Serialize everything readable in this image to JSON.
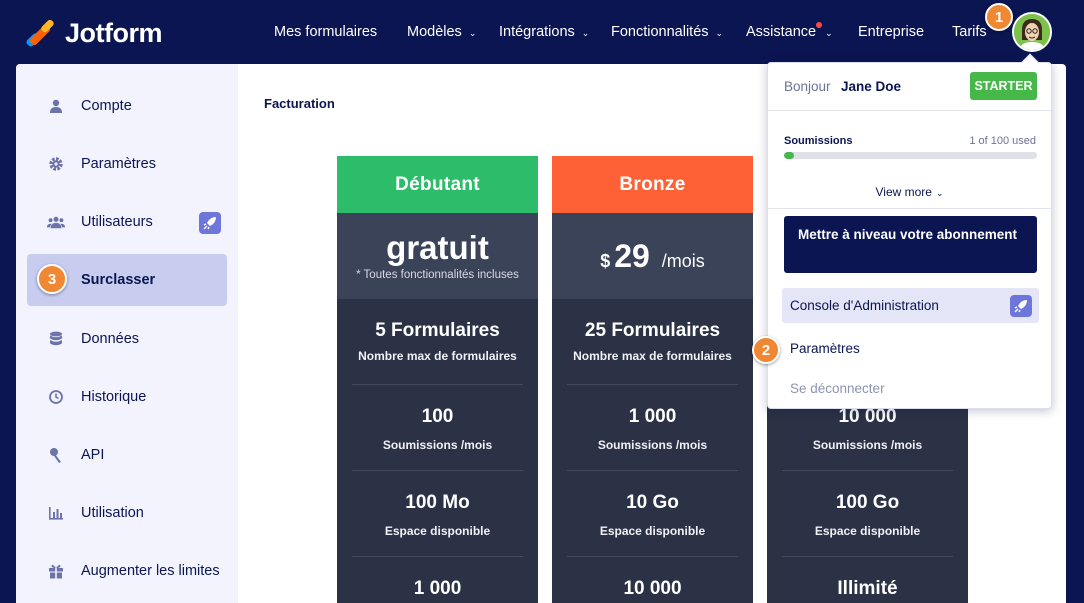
{
  "brand": {
    "name": "Jotform"
  },
  "nav": {
    "items": [
      {
        "label": "Mes formulaires",
        "dropdown": false
      },
      {
        "label": "Modèles",
        "dropdown": true
      },
      {
        "label": "Intégrations",
        "dropdown": true
      },
      {
        "label": "Fonctionnalités",
        "dropdown": true
      },
      {
        "label": "Assistance",
        "dropdown": true,
        "notification": true
      },
      {
        "label": "Entreprise",
        "dropdown": false
      },
      {
        "label": "Tarifs",
        "dropdown": false
      }
    ]
  },
  "callouts": {
    "one": "1",
    "two": "2",
    "three": "3"
  },
  "sidebar": {
    "items": [
      {
        "label": "Compte",
        "icon": "user-icon"
      },
      {
        "label": "Paramètres",
        "icon": "gear-icon"
      },
      {
        "label": "Utilisateurs",
        "icon": "users-icon",
        "badge": "rocket-icon"
      },
      {
        "label": "Surclasser",
        "icon": "upgrade-icon",
        "active": true
      },
      {
        "label": "Données",
        "icon": "database-icon"
      },
      {
        "label": "Historique",
        "icon": "history-icon"
      },
      {
        "label": "API",
        "icon": "api-icon"
      },
      {
        "label": "Utilisation",
        "icon": "chart-icon"
      },
      {
        "label": "Augmenter les limites",
        "icon": "gift-icon"
      }
    ]
  },
  "main": {
    "title": "Facturation"
  },
  "plans": [
    {
      "name": "Débutant",
      "color": "#2dbd6a",
      "price": "gratuit",
      "price_note": "* Toutes fonctionnalités incluses",
      "features": [
        {
          "value": "5 Formulaires",
          "label": "Nombre max de formulaires"
        },
        {
          "value": "100",
          "label": "Soumissions /mois"
        },
        {
          "value": "100 Mo",
          "label": "Espace disponible"
        },
        {
          "value": "1 000",
          "label": ""
        }
      ]
    },
    {
      "name": "Bronze",
      "color": "#ff6137",
      "currency": "$",
      "amount": "29",
      "period": "/mois",
      "features": [
        {
          "value": "25 Formulaires",
          "label": "Nombre max de formulaires"
        },
        {
          "value": "1 000",
          "label": "Soumissions /mois"
        },
        {
          "value": "10 Go",
          "label": "Espace disponible"
        },
        {
          "value": "10 000",
          "label": ""
        }
      ]
    },
    {
      "name": "",
      "features": [
        {
          "value": "10 000",
          "label": "Soumissions /mois"
        },
        {
          "value": "100 Go",
          "label": "Espace disponible"
        },
        {
          "value": "Illimité",
          "label": ""
        }
      ]
    }
  ],
  "account_menu": {
    "greeting": "Bonjour",
    "user_name": "Jane Doe",
    "plan_badge": "STARTER",
    "usage_label": "Soumissions",
    "usage_text": "1 of 100 used",
    "usage_fraction": 0.04,
    "view_more": "View more",
    "upgrade_button": "Mettre à niveau votre abonnement",
    "admin_console": "Console d'Administration",
    "settings": "Paramètres",
    "logout": "Se déconnecter"
  }
}
